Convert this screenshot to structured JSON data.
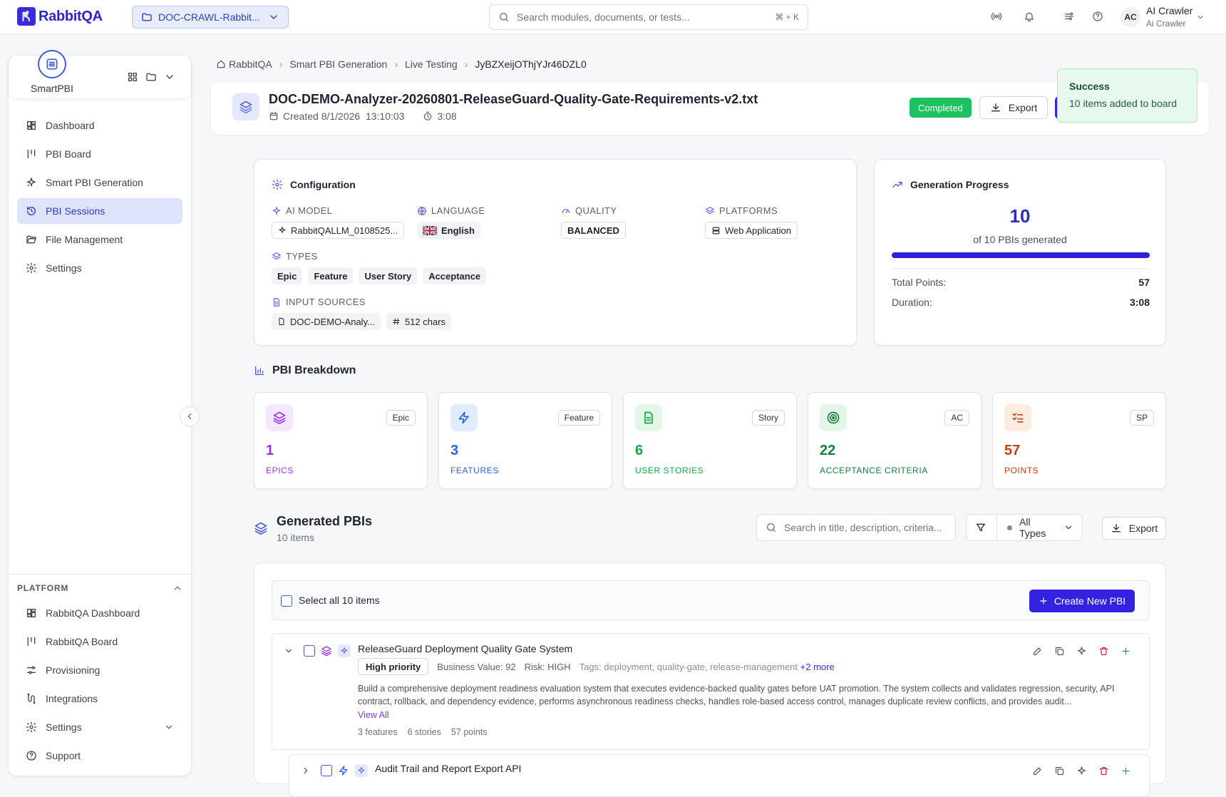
{
  "brand": {
    "name": "RabbitQA"
  },
  "project": {
    "name": "DOC-CRAWL-Rabbit..."
  },
  "search": {
    "placeholder": "Search modules, documents, or tests...",
    "shortcut": "⌘ + K"
  },
  "user": {
    "initials": "AC",
    "name": "AI Crawler",
    "role": "Ai Crawler"
  },
  "sidebar": {
    "title": "SmartPBI",
    "items": [
      {
        "label": "Dashboard",
        "icon": "dashboard-icon"
      },
      {
        "label": "PBI Board",
        "icon": "board-icon"
      },
      {
        "label": "Smart PBI Generation",
        "icon": "sparkle-icon"
      },
      {
        "label": "PBI Sessions",
        "icon": "history-icon",
        "active": true
      },
      {
        "label": "File Management",
        "icon": "folder-icon"
      },
      {
        "label": "Settings",
        "icon": "gear-icon"
      }
    ],
    "platform_label": "PLATFORM",
    "platform_items": [
      {
        "label": "RabbitQA Dashboard",
        "icon": "dashboard-icon"
      },
      {
        "label": "RabbitQA Board",
        "icon": "board-icon"
      },
      {
        "label": "Provisioning",
        "icon": "sliders-icon"
      },
      {
        "label": "Integrations",
        "icon": "integration-icon"
      },
      {
        "label": "Settings",
        "icon": "gear-icon"
      },
      {
        "label": "Support",
        "icon": "help-icon"
      }
    ]
  },
  "breadcrumb": [
    "RabbitQA",
    "Smart PBI Generation",
    "Live Testing",
    "JyBZXeijOThjYJr46DZL0"
  ],
  "session": {
    "title": "DOC-DEMO-Analyzer-20260801-ReleaseGuard-Quality-Gate-Requirements-v2.txt",
    "created": "Created 8/1/2026  13:10:03",
    "duration": "3:08",
    "status": "Completed",
    "export_label": "Export"
  },
  "toast": {
    "title": "Success",
    "message": "10 items added to board"
  },
  "config": {
    "title": "Configuration",
    "ai_model_label": "AI MODEL",
    "ai_model": "RabbitQALLM_0108525...",
    "language_label": "LANGUAGE",
    "language": "English",
    "quality_label": "QUALITY",
    "quality": "BALANCED",
    "platforms_label": "PLATFORMS",
    "platform": "Web Application",
    "types_label": "TYPES",
    "types": [
      "Epic",
      "Feature",
      "User Story",
      "Acceptance"
    ],
    "sources_label": "INPUT SOURCES",
    "source_file": "DOC-DEMO-Analy...",
    "source_chars": "512 chars"
  },
  "progress": {
    "title": "Generation Progress",
    "count": "10",
    "sub": "of 10 PBIs generated",
    "fraction": 1.0,
    "total_points_label": "Total Points:",
    "total_points": "57",
    "duration_label": "Duration:",
    "duration": "3:08"
  },
  "breakdown": {
    "title": "PBI Breakdown",
    "stats": [
      {
        "tag": "Epic",
        "value": "1",
        "label": "EPICS",
        "color": "#9333ea",
        "bg": "#f3e8ff",
        "icon": "layers-icon"
      },
      {
        "tag": "Feature",
        "value": "3",
        "label": "FEATURES",
        "color": "#2563eb",
        "bg": "#e0ecff",
        "icon": "bolt-icon"
      },
      {
        "tag": "Story",
        "value": "6",
        "label": "USER STORIES",
        "color": "#16a34a",
        "bg": "#e3f7e9",
        "icon": "document-icon"
      },
      {
        "tag": "AC",
        "value": "22",
        "label": "ACCEPTANCE CRITERIA",
        "color": "#15803d",
        "bg": "#e3f7e9",
        "icon": "target-icon"
      },
      {
        "tag": "SP",
        "value": "57",
        "label": "POINTS",
        "color": "#c2410c",
        "bg": "#fdece0",
        "icon": "checklist-icon"
      }
    ]
  },
  "generated": {
    "title": "Generated PBIs",
    "count": "10 items",
    "search_placeholder": "Search in title, description, criteria...",
    "filter": "All Types",
    "export_label": "Export",
    "select_all": "Select all 10 items",
    "create_label": "Create New PBI",
    "items": [
      {
        "title": "ReleaseGuard Deployment Quality Gate System",
        "priority": "High priority",
        "business_value": "Business Value: 92",
        "risk": "Risk: HIGH",
        "tags": "Tags: deployment, quality-gate, release-management",
        "more": "+2 more",
        "description": "Build a comprehensive deployment readiness evaluation system that executes evidence-backed quality gates before UAT promotion. The system collects and validates regression, security, API contract, rollback, and dependency evidence, performs asynchronous readiness checks, handles role-based access control, manages duplicate review conflicts, and provides audit...",
        "view_all": "View All",
        "features": "3 features",
        "stories": "6 stories",
        "points": "57 points"
      },
      {
        "title": "Audit Trail and Report Export API"
      }
    ]
  }
}
